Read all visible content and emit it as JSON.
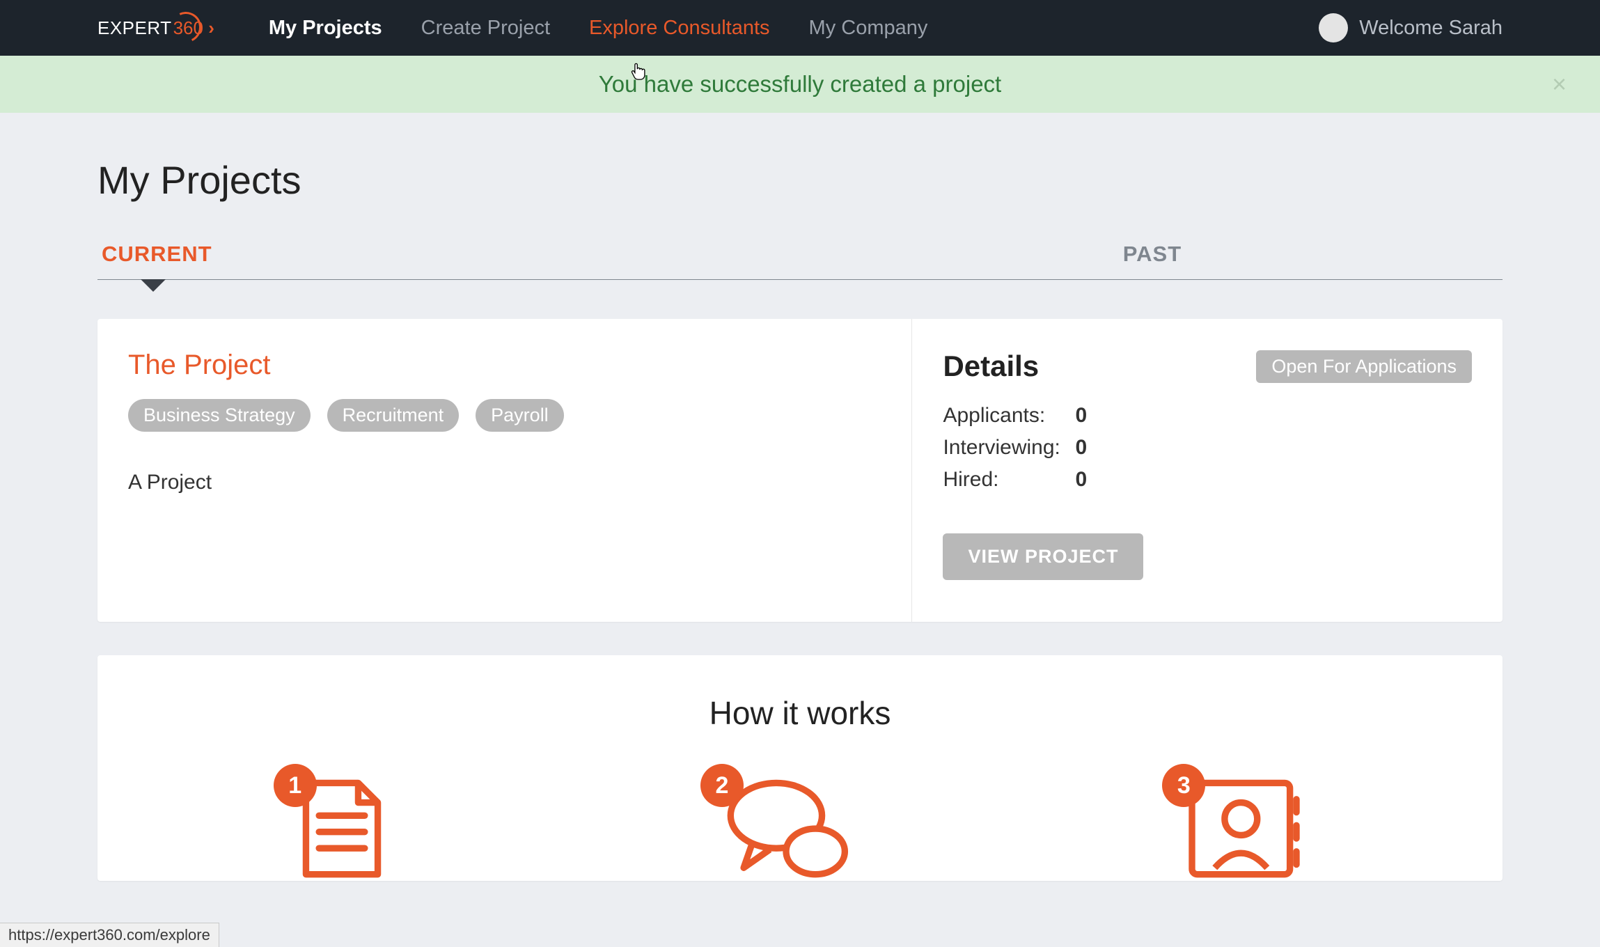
{
  "brand": {
    "part_a": "EXPERT",
    "part_b": "360"
  },
  "nav": {
    "items": [
      {
        "label": "My Projects",
        "state": "active"
      },
      {
        "label": "Create Project",
        "state": ""
      },
      {
        "label": "Explore Consultants",
        "state": "hover"
      },
      {
        "label": "My Company",
        "state": ""
      }
    ],
    "welcome": "Welcome Sarah"
  },
  "flash": {
    "message": "You have successfully created a project"
  },
  "page": {
    "title": "My Projects",
    "tabs": {
      "current": "CURRENT",
      "past": "PAST"
    }
  },
  "project": {
    "title": "The Project",
    "tags": [
      "Business Strategy",
      "Recruitment",
      "Payroll"
    ],
    "description": "A Project"
  },
  "details": {
    "heading": "Details",
    "status": "Open For Applications",
    "stats": [
      {
        "label": "Applicants:",
        "value": "0"
      },
      {
        "label": "Interviewing:",
        "value": "0"
      },
      {
        "label": "Hired:",
        "value": "0"
      }
    ],
    "view_button": "VIEW PROJECT"
  },
  "how": {
    "title": "How it works",
    "steps": [
      "1",
      "2",
      "3"
    ]
  },
  "status_bar_url": "https://expert360.com/explore",
  "colors": {
    "accent": "#e8592a"
  }
}
